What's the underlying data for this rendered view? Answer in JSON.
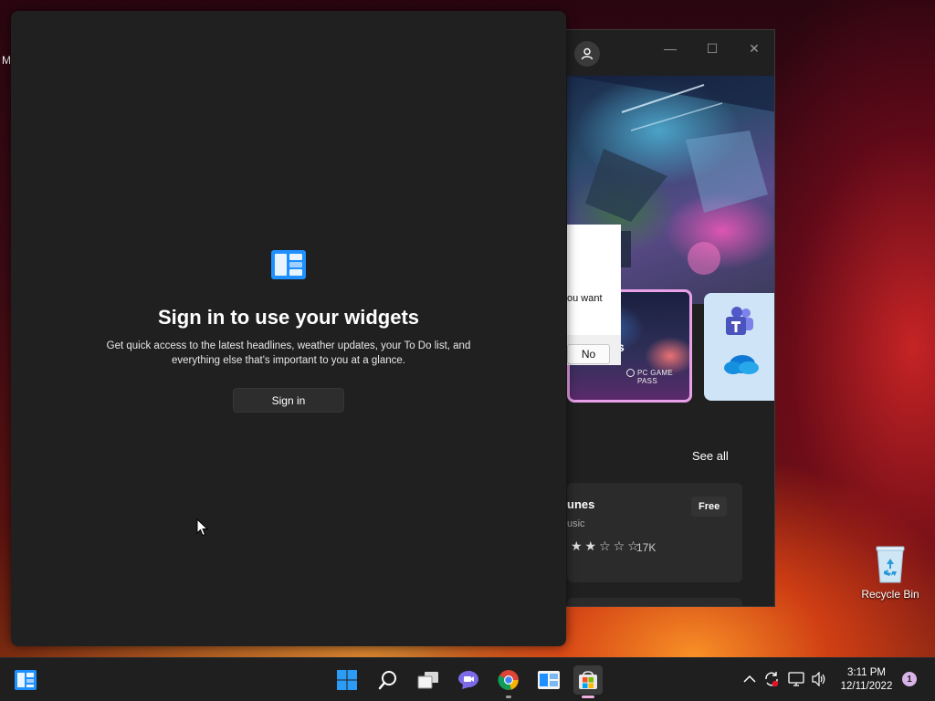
{
  "desktop": {
    "edge_label": "M",
    "recycle_bin_label": "Recycle Bin"
  },
  "store": {
    "dialog_text": "ou want",
    "dialog_no_label": "No",
    "card_label": "PC GAME PASS",
    "hero_partial_text": "s",
    "see_all_label": "See all",
    "app": {
      "name": "unes",
      "category": "usic",
      "rating": 2,
      "rating_max": 5,
      "review_count": "17K",
      "price": "Free"
    },
    "window_controls": {
      "minimize": "—",
      "maximize": "☐",
      "close": "✕"
    }
  },
  "widgets": {
    "title": "Sign in to use your widgets",
    "description": "Get quick access to the latest headlines, weather updates, your To Do list, and everything else that's important to you at a glance.",
    "signin_label": "Sign in"
  },
  "taskbar": {
    "apps": [
      "widgets",
      "start",
      "search",
      "task-view",
      "teams-chat",
      "chrome",
      "widgets-app",
      "microsoft-store"
    ],
    "clock_time": "3:11 PM",
    "clock_date": "12/11/2022",
    "notification_count": "1"
  },
  "colors": {
    "panel_bg": "#202020",
    "taskbar_bg": "#1f1f1f",
    "accent_blue": "#1e90ff",
    "store_card_border": "#e8a0e8"
  }
}
